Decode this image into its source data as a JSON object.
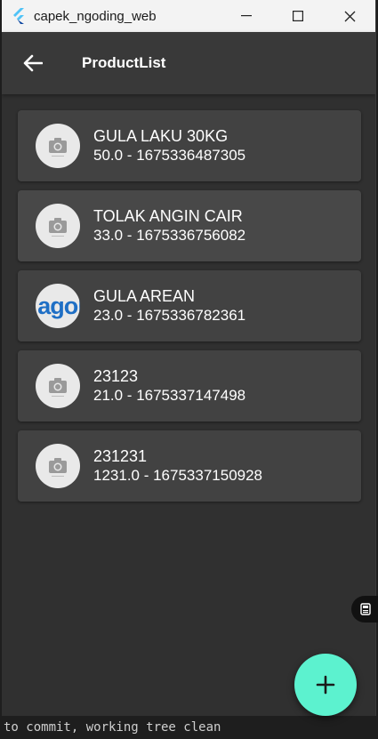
{
  "window": {
    "title": "capek_ngoding_web",
    "icons": {
      "app": "flutter-icon",
      "minimize": "minimize-icon",
      "maximize": "maximize-icon",
      "close": "close-icon"
    }
  },
  "appbar": {
    "title": "ProductList",
    "back_icon": "arrow-back-icon"
  },
  "products": [
    {
      "name": "GULA LAKU 30KG",
      "detail": "50.0 - 1675336487305",
      "image": "camera-placeholder"
    },
    {
      "name": "TOLAK ANGIN CAIR",
      "detail": "33.0 - 1675336756082",
      "image": "camera-placeholder"
    },
    {
      "name": "GULA AREAN",
      "detail": "23.0 - 1675336782361",
      "image": "logo",
      "image_text": "agol"
    },
    {
      "name": "23123",
      "detail": "21.0 - 1675337147498",
      "image": "camera-placeholder"
    },
    {
      "name": "231231",
      "detail": "1231.0 - 1675337150928",
      "image": "camera-placeholder"
    }
  ],
  "fab": {
    "icon": "plus-icon"
  },
  "side_tab": {
    "icon": "device-icon"
  },
  "background_terminal": "to commit, working tree clean",
  "colors": {
    "fab": "#5cf2cf",
    "card": "#424242",
    "background": "#303030",
    "appbar": "#393939"
  }
}
